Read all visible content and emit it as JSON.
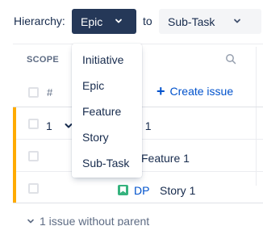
{
  "hierarchy": {
    "label": "Hierarchy:",
    "from_value": "Epic",
    "to_label": "to",
    "to_value": "Sub-Task"
  },
  "dropdown": {
    "options": [
      "Initiative",
      "Epic",
      "Feature",
      "Story",
      "Sub-Task"
    ]
  },
  "table": {
    "scope_header": "SCOPE",
    "number_header": "#",
    "create_issue": "Create issue",
    "rows": [
      {
        "number": "1",
        "text": ": 1"
      },
      {
        "text": "Feature 1"
      },
      {
        "key": "DP",
        "text": "Story 1"
      }
    ],
    "no_parent": "1 issue without parent"
  },
  "colors": {
    "accent_bar": "#ffab00",
    "link": "#0052cc",
    "select_dark": "#253858",
    "story_icon": "#36b37e"
  },
  "icons": [
    "chevron-down-icon",
    "search-icon",
    "plus-icon",
    "story-icon"
  ]
}
